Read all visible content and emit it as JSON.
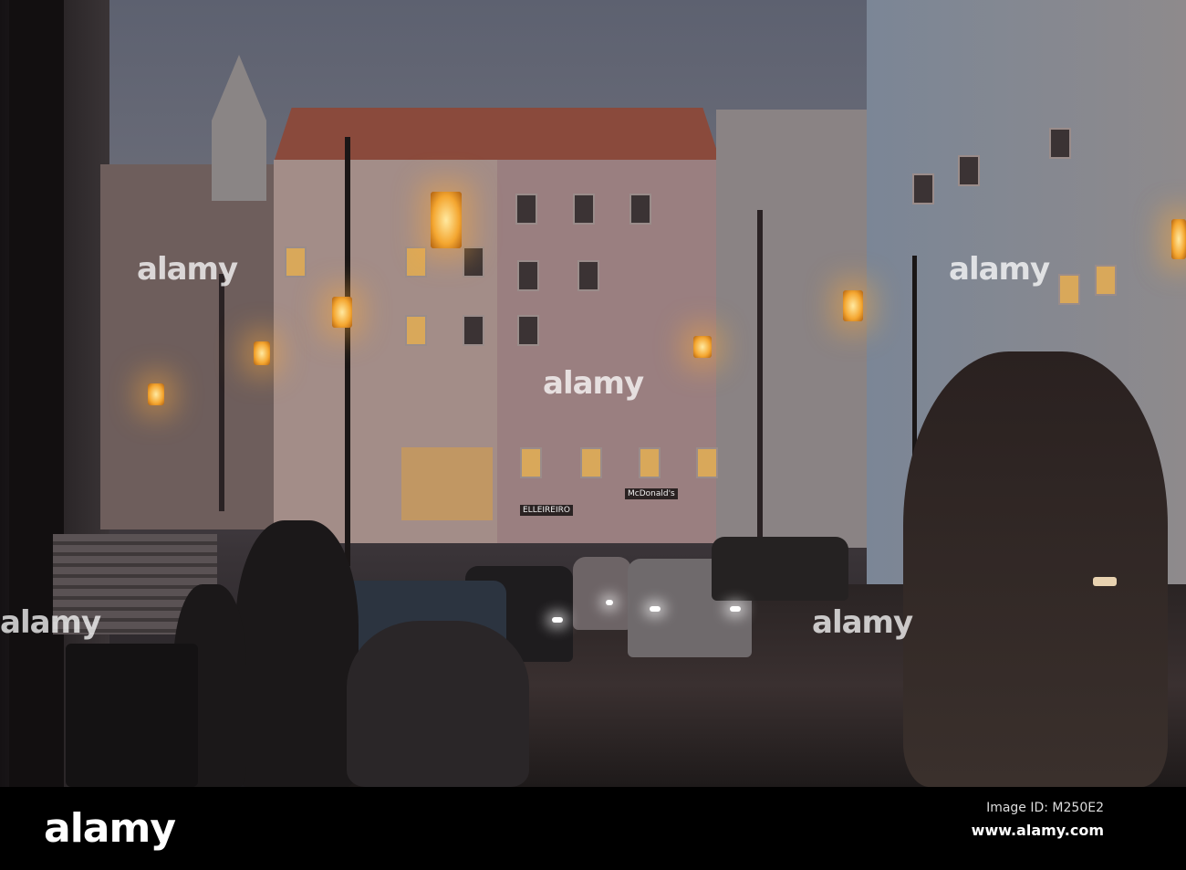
{
  "photo": {
    "signs": {
      "mcdonalds": "McDonald's",
      "shop": "ELLEIREIRO"
    },
    "watermark": "alamy"
  },
  "footer": {
    "logo": "alamy",
    "image_id": "Image ID: M250E2",
    "url": "www.alamy.com"
  },
  "colors": {
    "sky": "#5d6170",
    "lamp": "#f4a630",
    "bar": "#000000"
  }
}
